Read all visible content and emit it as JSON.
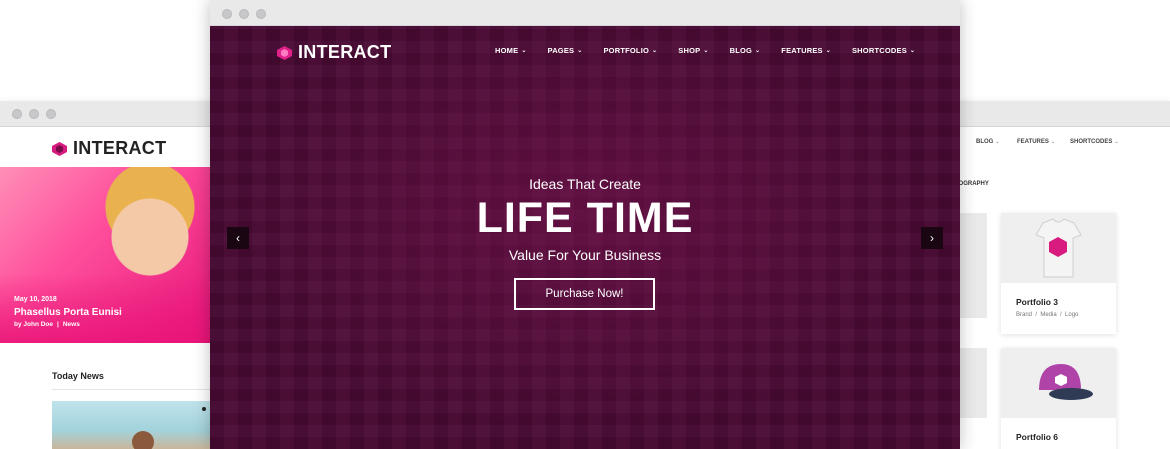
{
  "brand": {
    "name": "INTERACT",
    "accent": "#d81b7e"
  },
  "front": {
    "nav": [
      {
        "label": "HOME"
      },
      {
        "label": "PAGES"
      },
      {
        "label": "PORTFOLIO"
      },
      {
        "label": "SHOP"
      },
      {
        "label": "BLOG"
      },
      {
        "label": "FEATURES"
      },
      {
        "label": "SHORTCODES"
      }
    ],
    "hero": {
      "subtitle_top": "Ideas That Create",
      "title": "LIFE TIME",
      "subtitle_bottom": "Value For Your Business",
      "cta_label": "Purchase Now!",
      "background": "#4a0a34"
    },
    "arrows": {
      "prev_icon": "chevron-left-icon",
      "next_icon": "chevron-right-icon"
    }
  },
  "left": {
    "post": {
      "date": "May 10, 2018",
      "title": "Phasellus Porta Eunisi",
      "author": "by John Doe",
      "separator": "|",
      "category": "News"
    },
    "section_title": "Today News"
  },
  "right": {
    "nav": [
      {
        "label": "BLOG"
      },
      {
        "label": "FEATURES"
      },
      {
        "label": "SHORTCODES"
      }
    ],
    "filter_fragment": "TOGRAPHY",
    "cards": [
      {
        "title": "Portfolio 3",
        "tags": [
          "Brand",
          "Media",
          "Logo"
        ]
      },
      {
        "title": "Portfolio 6",
        "tags": []
      }
    ]
  }
}
